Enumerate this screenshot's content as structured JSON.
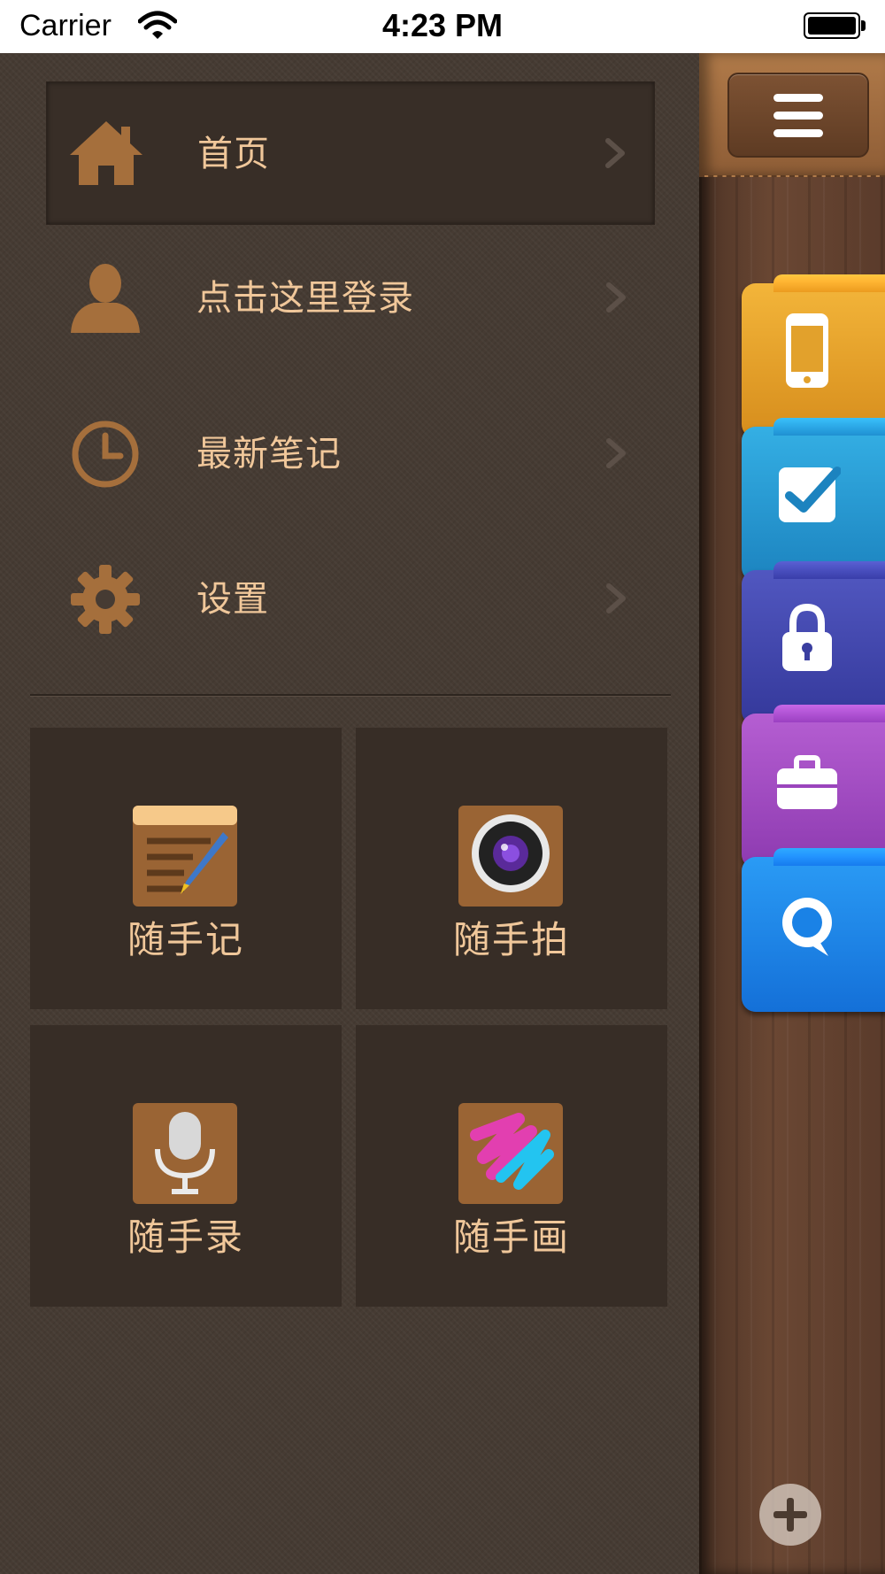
{
  "status_bar": {
    "carrier": "Carrier",
    "time": "4:23 PM"
  },
  "menu": {
    "items": [
      {
        "label": "首页",
        "icon": "home-icon",
        "active": true
      },
      {
        "label": "点击这里登录",
        "icon": "user-icon",
        "active": false
      },
      {
        "label": "最新笔记",
        "icon": "clock-icon",
        "active": false
      },
      {
        "label": "设置",
        "icon": "gear-icon",
        "active": false
      }
    ],
    "tiles": [
      {
        "label": "随手记",
        "icon": "notepad-pen-icon"
      },
      {
        "label": "随手拍",
        "icon": "camera-icon"
      },
      {
        "label": "随手录",
        "icon": "microphone-icon"
      },
      {
        "label": "随手画",
        "icon": "paint-strokes-icon"
      }
    ]
  },
  "content": {
    "tabs": [
      {
        "icon": "phone-icon",
        "color": "#e8a528"
      },
      {
        "icon": "checkbox-icon",
        "color": "#2a9fd6"
      },
      {
        "icon": "lock-icon",
        "color": "#4a4fb0"
      },
      {
        "icon": "briefcase-icon",
        "color": "#a24fc2"
      },
      {
        "icon": "chat-bubble-icon",
        "color": "#1e8cf0"
      }
    ]
  },
  "colors": {
    "menu_text": "#f0c79a",
    "menu_background": "#463b33",
    "icon_brown": "#a56f3c"
  }
}
